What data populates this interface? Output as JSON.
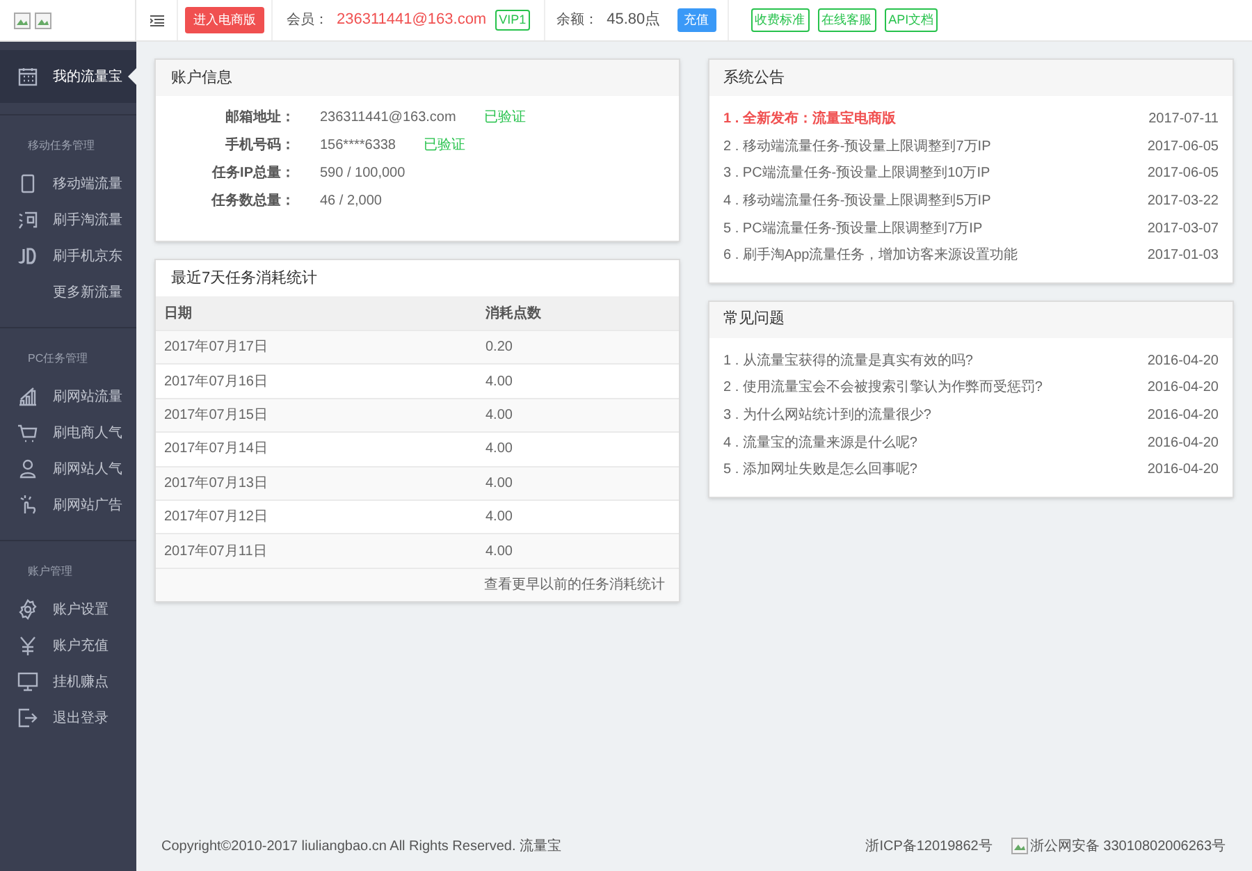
{
  "header": {
    "ecommerce_button": "进入电商版",
    "member_label": "会员：",
    "member_email": "236311441@163.com",
    "vip_badge": "VIP1",
    "balance_label": "余额：",
    "balance_value": "45.80点",
    "recharge_button": "充值",
    "links": [
      "收费标准",
      "在线客服",
      "API文档"
    ]
  },
  "sidebar": {
    "top": {
      "label": "我的流量宝",
      "selected": true
    },
    "sections": [
      {
        "title": "移动任务管理",
        "items": [
          {
            "label": "移动端流量",
            "kind": "phone"
          },
          {
            "label": "刷手淘流量",
            "kind": "tao"
          },
          {
            "label": "刷手机京东",
            "kind": "jd"
          },
          {
            "label": "更多新流量",
            "kind": "plain"
          }
        ]
      },
      {
        "title": "PC任务管理",
        "items": [
          {
            "label": "刷网站流量",
            "kind": "bars"
          },
          {
            "label": "刷电商人气",
            "kind": "cart"
          },
          {
            "label": "刷网站人气",
            "kind": "user"
          },
          {
            "label": "刷网站广告",
            "kind": "click"
          }
        ]
      },
      {
        "title": "账户管理",
        "items": [
          {
            "label": "账户设置",
            "kind": "gear"
          },
          {
            "label": "账户充值",
            "kind": "yen"
          },
          {
            "label": "挂机赚点",
            "kind": "monitor"
          },
          {
            "label": "退出登录",
            "kind": "exit"
          }
        ]
      }
    ]
  },
  "account": {
    "title": "账户信息",
    "rows": [
      {
        "label": "邮箱地址：",
        "value": "236311441@163.com",
        "status": "已验证"
      },
      {
        "label": "手机号码：",
        "value": "156****6338",
        "status": "已验证"
      },
      {
        "label": "任务IP总量：",
        "value": "590 / 100,000"
      },
      {
        "label": "任务数总量：",
        "value": "46 / 2,000"
      }
    ]
  },
  "stats": {
    "title": "最近7天任务消耗统计",
    "columns": [
      "日期",
      "消耗点数"
    ],
    "rows": [
      [
        "2017年07月17日",
        "0.20"
      ],
      [
        "2017年07月16日",
        "4.00"
      ],
      [
        "2017年07月15日",
        "4.00"
      ],
      [
        "2017年07月14日",
        "4.00"
      ],
      [
        "2017年07月13日",
        "4.00"
      ],
      [
        "2017年07月12日",
        "4.00"
      ],
      [
        "2017年07月11日",
        "4.00"
      ]
    ],
    "more_link": "查看更早以前的任务消耗统计"
  },
  "notices": {
    "title": "系统公告",
    "items": [
      {
        "text": "1 . 全新发布：流量宝电商版",
        "date": "2017-07-11",
        "highlight": true
      },
      {
        "text": "2 . 移动端流量任务-预设量上限调整到7万IP",
        "date": "2017-06-05",
        "highlight": false
      },
      {
        "text": "3 . PC端流量任务-预设量上限调整到10万IP",
        "date": "2017-06-05",
        "highlight": false
      },
      {
        "text": "4 . 移动端流量任务-预设量上限调整到5万IP",
        "date": "2017-03-22",
        "highlight": false
      },
      {
        "text": "5 . PC端流量任务-预设量上限调整到7万IP",
        "date": "2017-03-07",
        "highlight": false
      },
      {
        "text": "6 . 刷手淘App流量任务，增加访客来源设置功能",
        "date": "2017-01-03",
        "highlight": false
      }
    ]
  },
  "faq": {
    "title": "常见问题",
    "items": [
      {
        "text": "1 . 从流量宝获得的流量是真实有效的吗?",
        "date": "2016-04-20"
      },
      {
        "text": "2 . 使用流量宝会不会被搜索引擎认为作弊而受惩罚?",
        "date": "2016-04-20"
      },
      {
        "text": "3 . 为什么网站统计到的流量很少?",
        "date": "2016-04-20"
      },
      {
        "text": "4 . 流量宝的流量来源是什么呢?",
        "date": "2016-04-20"
      },
      {
        "text": "5 . 添加网址失败是怎么回事呢?",
        "date": "2016-04-20"
      }
    ]
  },
  "footer": {
    "copyright": "Copyright©2010-2017 liuliangbao.cn All Rights Reserved. 流量宝",
    "icp": "浙ICP备12019862号",
    "police": "浙公网安备 33010802006263号"
  }
}
